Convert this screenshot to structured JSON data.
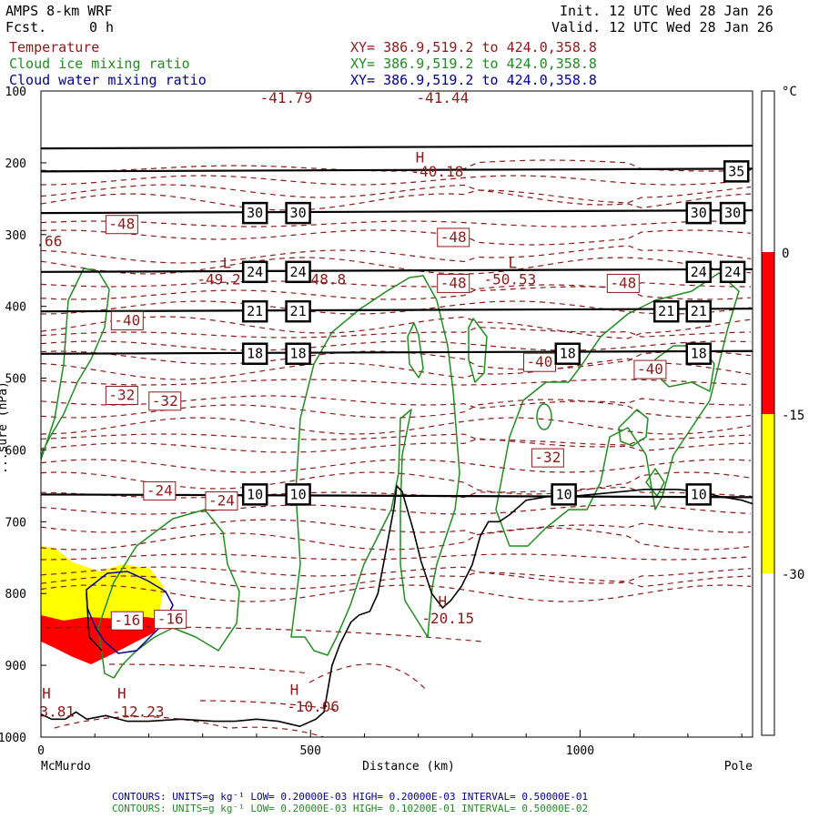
{
  "header": {
    "model": "AMPS 8-km WRF",
    "fcst_label": "Fcst.",
    "fcst_value": "0 h",
    "init": "Init. 12 UTC Wed 28 Jan 26",
    "valid": "Valid. 12 UTC Wed 28 Jan 26",
    "fields": [
      {
        "name": "Temperature",
        "xy": "XY= 386.9,519.2 to 424.0,358.8",
        "color": "#8b1a1a"
      },
      {
        "name": "Cloud ice mixing ratio",
        "xy": "XY= 386.9,519.2 to 424.0,358.8",
        "color": "#228b22"
      },
      {
        "name": "Cloud water mixing ratio",
        "xy": "XY= 386.9,519.2 to 424.0,358.8",
        "color": "#00008b"
      }
    ]
  },
  "colorbar": {
    "unit": "°C",
    "labels": [
      "0",
      "-15",
      "-30"
    ],
    "bands": [
      {
        "range": "above 0",
        "color": "#ffffff"
      },
      {
        "range": "0 to -15",
        "color": "#ff0000"
      },
      {
        "range": "-15 to -30",
        "color": "#ffff00"
      },
      {
        "range": "below -30",
        "color": "#ffffff"
      }
    ]
  },
  "footer": [
    {
      "text": "CONTOURS:  UNITS=g kg⁻¹  LOW= 0.20000E-03  HIGH= 0.20000E-03  INTERVAL=  0.50000E-01",
      "color": "#00008b"
    },
    {
      "text": "CONTOURS:  UNITS=g kg⁻¹  LOW= 0.20000E-03  HIGH= 0.10200E-01  INTERVAL=  0.50000E-02",
      "color": "#228b22"
    }
  ],
  "chart_data": {
    "type": "cross-section",
    "xlabel": "Distance (km)",
    "x_start_label": "McMurdo",
    "x_end_label": "Pole",
    "xlim": [
      0,
      1320
    ],
    "x_ticks": [
      0,
      500,
      1000
    ],
    "ylim": [
      1000,
      100
    ],
    "y_ticks": [
      100,
      200,
      300,
      400,
      500,
      600,
      700,
      800,
      900,
      1000
    ],
    "ylabel_visible": "...sure (hPa)",
    "isentropes": [
      {
        "label": "35",
        "p": 212,
        "label_x": [
          1290
        ]
      },
      {
        "label": "30",
        "p": 270,
        "label_x": [
          397,
          477,
          1220,
          1283
        ]
      },
      {
        "label": "24",
        "p": 352,
        "label_x": [
          397,
          477,
          1220,
          1283
        ]
      },
      {
        "label": "21",
        "p": 407,
        "label_x": [
          397,
          477,
          1160,
          1220
        ]
      },
      {
        "label": "18",
        "p": 466,
        "label_x": [
          397,
          477,
          977,
          1220
        ]
      },
      {
        "label": "10",
        "p": 662,
        "label_x": [
          397,
          477,
          970,
          1220
        ]
      },
      {
        "label": "",
        "p": 180,
        "label_x": []
      }
    ],
    "temperature_labels": [
      {
        "text": "-41.79",
        "x": 455,
        "p": 110
      },
      {
        "text": "-41.44",
        "x": 745,
        "p": 110
      },
      {
        "text": "H",
        "x": 703,
        "p": 193
      },
      {
        "text": "-40.18",
        "x": 735,
        "p": 213
      },
      {
        "text": "-48",
        "x": 150,
        "p": 286
      },
      {
        "text": ".66",
        "x": 15,
        "p": 310
      },
      {
        "text": "-48",
        "x": 765,
        "p": 304
      },
      {
        "text": "L",
        "x": 345,
        "p": 340
      },
      {
        "text": "-49.2",
        "x": 330,
        "p": 363
      },
      {
        "text": "-48.8",
        "x": 525,
        "p": 363
      },
      {
        "text": "L",
        "x": 875,
        "p": 340
      },
      {
        "text": "-50.53",
        "x": 870,
        "p": 363
      },
      {
        "text": "-48",
        "x": 765,
        "p": 368
      },
      {
        "text": "-48",
        "x": 1080,
        "p": 368
      },
      {
        "text": "-40",
        "x": 160,
        "p": 420
      },
      {
        "text": "-40",
        "x": 925,
        "p": 478
      },
      {
        "text": "-40",
        "x": 1130,
        "p": 488
      },
      {
        "text": "-32",
        "x": 150,
        "p": 524
      },
      {
        "text": "-32",
        "x": 230,
        "p": 532
      },
      {
        "text": "-32",
        "x": 940,
        "p": 611
      },
      {
        "text": "-24",
        "x": 220,
        "p": 657
      },
      {
        "text": "-24",
        "x": 335,
        "p": 671
      },
      {
        "text": "-16",
        "x": 160,
        "p": 838
      },
      {
        "text": "-16",
        "x": 240,
        "p": 836
      },
      {
        "text": "H",
        "x": 745,
        "p": 812
      },
      {
        "text": "-20.15",
        "x": 755,
        "p": 835
      },
      {
        "text": "H",
        "x": 10,
        "p": 940
      },
      {
        "text": "3.81",
        "x": 30,
        "p": 965
      },
      {
        "text": "H",
        "x": 150,
        "p": 940
      },
      {
        "text": "-12.23",
        "x": 180,
        "p": 965
      },
      {
        "text": "H",
        "x": 470,
        "p": 935
      },
      {
        "text": "-10.06",
        "x": 505,
        "p": 958
      }
    ],
    "terrain": [
      [
        0,
        968
      ],
      [
        20,
        975
      ],
      [
        45,
        975
      ],
      [
        65,
        965
      ],
      [
        85,
        975
      ],
      [
        120,
        970
      ],
      [
        160,
        978
      ],
      [
        200,
        978
      ],
      [
        260,
        975
      ],
      [
        320,
        978
      ],
      [
        360,
        978
      ],
      [
        400,
        975
      ],
      [
        440,
        978
      ],
      [
        480,
        985
      ],
      [
        510,
        975
      ],
      [
        525,
        965
      ],
      [
        540,
        900
      ],
      [
        555,
        870
      ],
      [
        575,
        840
      ],
      [
        590,
        830
      ],
      [
        610,
        825
      ],
      [
        625,
        800
      ],
      [
        640,
        740
      ],
      [
        655,
        680
      ],
      [
        660,
        650
      ],
      [
        670,
        658
      ],
      [
        690,
        710
      ],
      [
        705,
        755
      ],
      [
        725,
        800
      ],
      [
        745,
        820
      ],
      [
        760,
        810
      ],
      [
        780,
        790
      ],
      [
        800,
        760
      ],
      [
        815,
        720
      ],
      [
        830,
        700
      ],
      [
        850,
        700
      ],
      [
        870,
        690
      ],
      [
        900,
        670
      ],
      [
        940,
        665
      ],
      [
        980,
        665
      ],
      [
        1050,
        660
      ],
      [
        1120,
        655
      ],
      [
        1180,
        655
      ],
      [
        1220,
        658
      ],
      [
        1260,
        665
      ],
      [
        1300,
        670
      ],
      [
        1320,
        675
      ]
    ]
  }
}
